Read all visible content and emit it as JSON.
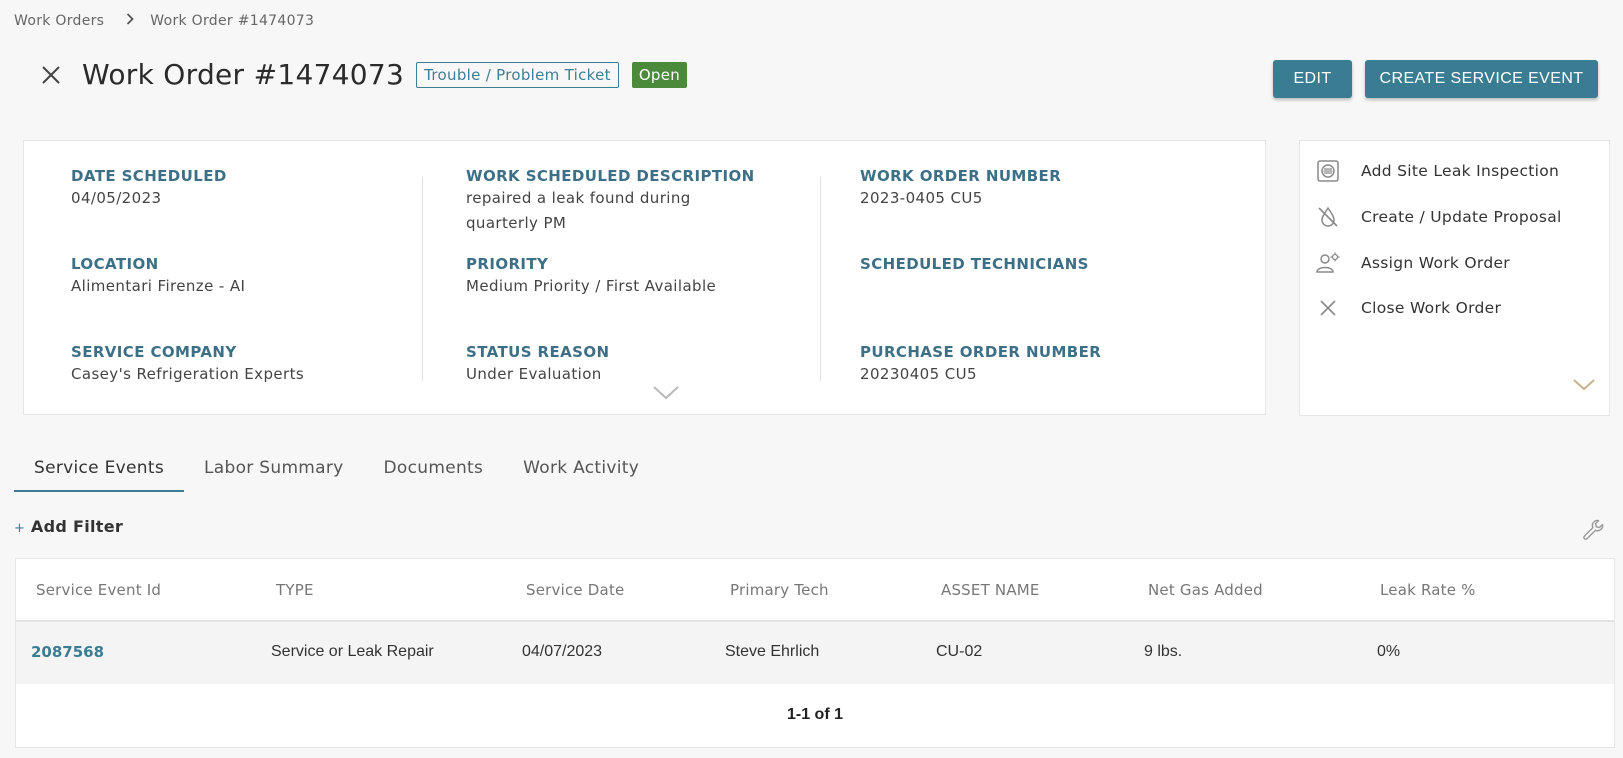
{
  "breadcrumb": {
    "root": "Work Orders",
    "current": "Work Order #1474073"
  },
  "header": {
    "title": "Work Order #1474073",
    "type_badge": "Trouble / Problem Ticket",
    "status": "Open",
    "status_color": "#4a8a3a"
  },
  "buttons": {
    "edit": "EDIT",
    "create_service_event": "CREATE SERVICE EVENT",
    "accent": "#3a7d93"
  },
  "details": {
    "date_scheduled": {
      "label": "DATE SCHEDULED",
      "value": "04/05/2023"
    },
    "location": {
      "label": "LOCATION",
      "value": "Alimentari Firenze - AI"
    },
    "service_company": {
      "label": "SERVICE COMPANY",
      "value": "Casey's Refrigeration Experts"
    },
    "work_description": {
      "label": "WORK SCHEDULED DESCRIPTION",
      "line1": "repaired a leak found during",
      "line2": "quarterly PM"
    },
    "priority": {
      "label": "PRIORITY",
      "value": "Medium Priority / First Available"
    },
    "status_reason": {
      "label": "STATUS REASON",
      "value": "Under Evaluation"
    },
    "work_order_number": {
      "label": "WORK ORDER NUMBER",
      "value": "2023-0405 CU5"
    },
    "scheduled_technicians": {
      "label": "SCHEDULED TECHNICIANS",
      "value": ""
    },
    "purchase_order_number": {
      "label": "PURCHASE ORDER NUMBER",
      "value": "20230405 CU5"
    }
  },
  "actions": [
    {
      "label": "Add Site Leak Inspection",
      "icon": "inspection-icon"
    },
    {
      "label": "Create / Update Proposal",
      "icon": "proposal-icon"
    },
    {
      "label": "Assign Work Order",
      "icon": "assign-technician-icon"
    },
    {
      "label": "Close Work Order",
      "icon": "close-icon"
    }
  ],
  "tabs": [
    {
      "label": "Service Events",
      "active": true
    },
    {
      "label": "Labor Summary",
      "active": false
    },
    {
      "label": "Documents",
      "active": false
    },
    {
      "label": "Work Activity",
      "active": false
    }
  ],
  "filter": {
    "plus": "+",
    "label": "Add Filter"
  },
  "table": {
    "columns": [
      "Service Event Id",
      "TYPE",
      "Service Date",
      "Primary Tech",
      "ASSET NAME",
      "Net Gas Added",
      "Leak Rate %"
    ],
    "rows": [
      [
        "2087568",
        "Service or Leak Repair",
        "04/07/2023",
        "Steve Ehrlich",
        "CU-02",
        "9 lbs.",
        "0%"
      ]
    ],
    "pagination": "1-1 of 1"
  }
}
